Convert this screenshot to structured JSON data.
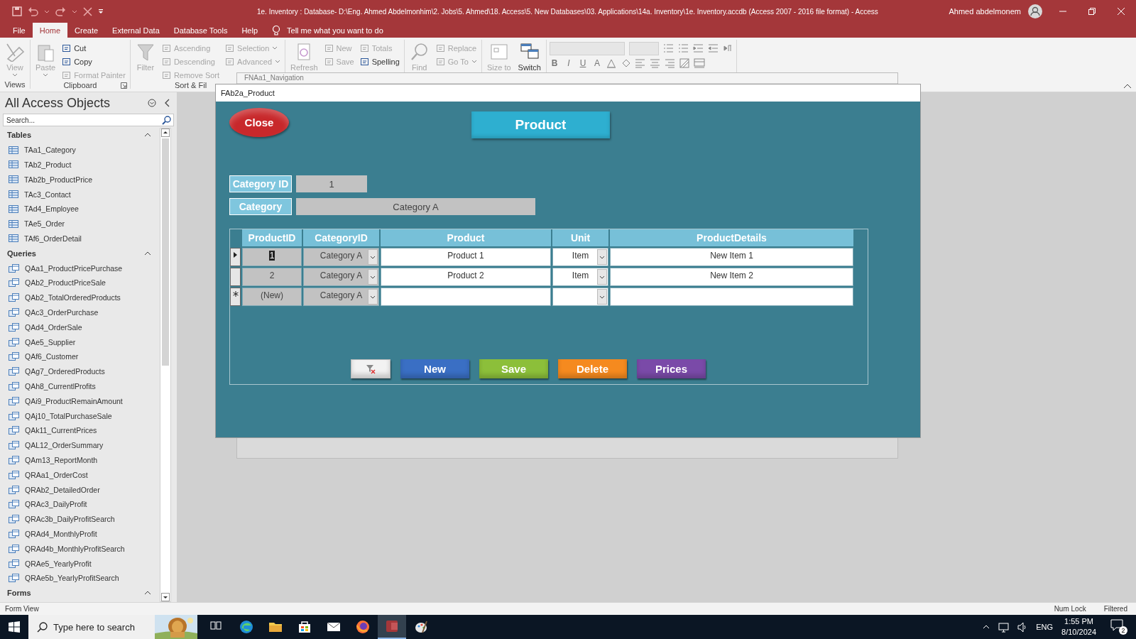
{
  "title_bar": {
    "title": "1e. Inventory : Database- D:\\Eng. Ahmed Abdelmonhim\\2. Jobs\\5. Ahmed\\18. Access\\5. New Databases\\03. Applications\\14a. Inventory\\1e. Inventory.accdb (Access 2007 - 2016 file format)  -  Access",
    "user": "Ahmed abdelmonem"
  },
  "ribbon_tabs": [
    {
      "label": "File",
      "selected": false
    },
    {
      "label": "Home",
      "selected": true
    },
    {
      "label": "Create",
      "selected": false
    },
    {
      "label": "External Data",
      "selected": false
    },
    {
      "label": "Database Tools",
      "selected": false
    },
    {
      "label": "Help",
      "selected": false
    }
  ],
  "tell_me": "Tell me what you want to do",
  "ribbon_groups": [
    {
      "label": "Views",
      "large": [
        {
          "label": "View",
          "disabled": true,
          "dropdown": true
        }
      ]
    },
    {
      "label": "Clipboard",
      "launcher": true,
      "large": [
        {
          "label": "Paste",
          "disabled": true,
          "dropdown": true
        }
      ],
      "columns": [
        [
          {
            "label": "Cut",
            "disabled": false,
            "dropdown": false
          },
          {
            "label": "Copy",
            "disabled": false,
            "dropdown": false
          },
          {
            "label": "Format Painter",
            "disabled": true,
            "dropdown": false
          }
        ]
      ]
    },
    {
      "label": "Sort & Fil",
      "large": [
        {
          "label": "Filter",
          "disabled": true,
          "dropdown": false
        }
      ],
      "columns": [
        [
          {
            "label": "Ascending",
            "disabled": true,
            "dropdown": false
          },
          {
            "label": "Descending",
            "disabled": true,
            "dropdown": false
          },
          {
            "label": "Remove Sort",
            "disabled": true,
            "dropdown": false
          }
        ],
        [
          {
            "label": "Selection",
            "disabled": true,
            "dropdown": true
          },
          {
            "label": "Advanced",
            "disabled": true,
            "dropdown": true
          }
        ]
      ]
    },
    {
      "large": [
        {
          "label": "Refresh",
          "disabled": true,
          "dropdown": false
        }
      ],
      "columns": [
        [
          {
            "label": "New",
            "disabled": true,
            "dropdown": false
          },
          {
            "label": "Save",
            "disabled": true,
            "dropdown": false
          }
        ],
        [
          {
            "label": "Totals",
            "disabled": true,
            "dropdown": false
          },
          {
            "label": "Spelling",
            "disabled": false,
            "dropdown": false
          }
        ]
      ]
    },
    {
      "large": [
        {
          "label": "Find",
          "disabled": true,
          "dropdown": false
        }
      ],
      "columns": [
        [
          {
            "label": "Replace",
            "disabled": true,
            "dropdown": false
          },
          {
            "label": "Go To",
            "disabled": true,
            "dropdown": true
          }
        ]
      ]
    },
    {
      "large": [
        {
          "label": "Size to",
          "disabled": true,
          "dropdown": false
        },
        {
          "label": "Switch",
          "disabled": false,
          "dropdown": false
        }
      ]
    }
  ],
  "text_formatting": {
    "format_buttons": [
      "B",
      "I",
      "U",
      "A"
    ]
  },
  "nav_pane": {
    "title": "All Access Objects",
    "search_placeholder": "Search...",
    "groups": [
      {
        "label": "Tables",
        "kind": "table",
        "expanded": true,
        "items": [
          "TAa1_Category",
          "TAb2_Product",
          "TAb2b_ProductPrice",
          "TAc3_Contact",
          "TAd4_Employee",
          "TAe5_Order",
          "TAf6_OrderDetail"
        ]
      },
      {
        "label": "Queries",
        "kind": "query",
        "expanded": true,
        "items": [
          "QAa1_ProductPricePurchase",
          "QAb2_ProductPriceSale",
          "QAb2_TotalOrderedProducts",
          "QAc3_OrderPurchase",
          "QAd4_OrderSale",
          "QAe5_Supplier",
          "QAf6_Customer",
          "QAg7_OrderedProducts",
          "QAh8_CurrentlProfits",
          "QAi9_ProductRemainAmount",
          "QAj10_TotalPurchaseSale",
          "QAk11_CurrentPrices",
          "QAL12_OrderSummary",
          "QAm13_ReportMonth",
          "QRAa1_OrderCost",
          "QRAb2_DetailedOrder",
          "QRAc3_DailyProfit",
          "QRAc3b_DailyProfitSearch",
          "QRAd4_MonthlyProfit",
          "QRAd4b_MonthlyProfitSearch",
          "QRAe5_YearlyProfit",
          "QRAe5b_YearlyProfitSearch"
        ]
      },
      {
        "label": "Forms",
        "expanded": true
      }
    ]
  },
  "background_window": {
    "title": "FNAa1_Navigation"
  },
  "form": {
    "title": "FAb2a_Product",
    "close_button": "Close",
    "heading": "Product",
    "fields": [
      {
        "label": "Category ID",
        "value": "1"
      },
      {
        "label": "Category",
        "value": "Category A"
      }
    ],
    "subform": {
      "columns": [
        {
          "label": "ProductID",
          "kind": "locked"
        },
        {
          "label": "CategoryID",
          "kind": "lockedcombo"
        },
        {
          "label": "Product",
          "kind": "text"
        },
        {
          "label": "Unit",
          "kind": "combo"
        },
        {
          "label": "ProductDetails",
          "kind": "text"
        }
      ],
      "rows": [
        {
          "current": true,
          "new": false,
          "cells": [
            "1",
            "Category A",
            "Product 1",
            "Item",
            "New Item 1"
          ]
        },
        {
          "current": false,
          "new": false,
          "cells": [
            "2",
            "Category A",
            "Product 2",
            "Item",
            "New Item 2"
          ]
        },
        {
          "current": false,
          "new": true,
          "cells": [
            "(New)",
            "Category A",
            null,
            null,
            null
          ]
        }
      ]
    },
    "buttons": [
      {
        "kind": "icon",
        "color": "#f2f2f2"
      },
      {
        "kind": "label",
        "label": "New",
        "color": "#3a6fc4"
      },
      {
        "kind": "label",
        "label": "Save",
        "color": "#8cbf3a"
      },
      {
        "kind": "label",
        "label": "Delete",
        "color": "#f58a1f"
      },
      {
        "kind": "label",
        "label": "Prices",
        "color": "#7a4aa8"
      }
    ]
  },
  "status_bar": {
    "view": "Form View",
    "indicators": [
      "Num Lock",
      "Filtered"
    ]
  },
  "taskbar": {
    "search_placeholder": "Type here to search",
    "apps": [
      {
        "kind": "taskview",
        "selected": false
      },
      {
        "kind": "browser",
        "selected": false
      },
      {
        "kind": "folder",
        "selected": false
      },
      {
        "kind": "store",
        "selected": false
      },
      {
        "kind": "mail",
        "selected": false
      },
      {
        "kind": "fox",
        "selected": false
      },
      {
        "kind": "database",
        "selected": true
      },
      {
        "kind": "paint",
        "selected": false
      }
    ],
    "language": "ENG",
    "time": "1:55 PM",
    "date": "8/10/2024",
    "notifications": "2"
  }
}
